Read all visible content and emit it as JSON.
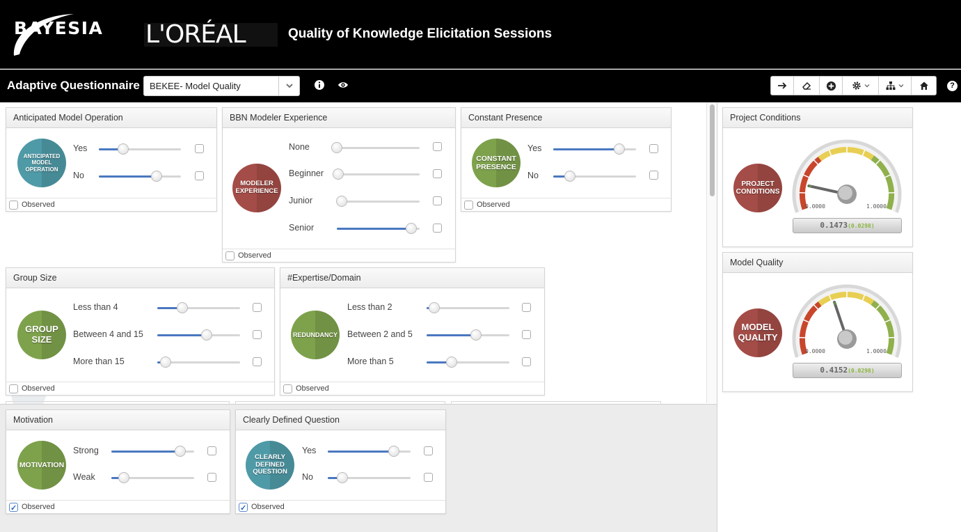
{
  "header": {
    "bayesia_logo": "BAYESIA",
    "loreal_logo": "L'ORÉAL",
    "title": "Quality of Knowledge Elicitation Sessions"
  },
  "toolbar": {
    "title": "Adaptive Questionnaire",
    "questionnaire_select": "BEKEE- Model Quality",
    "icons": [
      "info-icon",
      "eye-icon",
      "arrow-right-icon",
      "eraser-icon",
      "plus-circle-icon",
      "gear-icon",
      "hierarchy-icon",
      "home-icon",
      "help-icon"
    ],
    "help": "?"
  },
  "observed_label": "Observed",
  "colors": {
    "teal": "#4f9aa7",
    "red": "#a44c47",
    "green": "#7ea24c",
    "slider_fill": "#4a78c0"
  },
  "cards": {
    "anticipated": {
      "title": "Anticipated Model Operation",
      "node": "ANTICIPATED MODEL OPERATION",
      "states": [
        {
          "label": "Yes",
          "value": 0.3
        },
        {
          "label": "No",
          "value": 0.7
        }
      ],
      "observed": false
    },
    "experience": {
      "title": "BBN Modeler Experience",
      "node": "MODELER EXPERIENCE",
      "states": [
        {
          "label": "None",
          "value": 0.0
        },
        {
          "label": "Beginner",
          "value": 0.02
        },
        {
          "label": "Junior",
          "value": 0.06
        },
        {
          "label": "Senior",
          "value": 0.9
        }
      ],
      "observed": false
    },
    "presence": {
      "title": "Constant Presence",
      "node": "CONSTANT PRESENCE",
      "states": [
        {
          "label": "Yes",
          "value": 0.8
        },
        {
          "label": "No",
          "value": 0.2
        }
      ],
      "observed": false
    },
    "group_size": {
      "title": "Group Size",
      "node": "GROUP SIZE",
      "states": [
        {
          "label": "Less than 4",
          "value": 0.3
        },
        {
          "label": "Between 4 and 15",
          "value": 0.6
        },
        {
          "label": "More than 15",
          "value": 0.1
        }
      ],
      "observed": false
    },
    "expertise": {
      "title": "#Expertise/Domain",
      "node": "REDUNDANCY",
      "states": [
        {
          "label": "Less than 2",
          "value": 0.09
        },
        {
          "label": "Between 2 and 5",
          "value": 0.6
        },
        {
          "label": "More than 5",
          "value": 0.3
        }
      ],
      "observed": false
    },
    "motivation": {
      "title": "Motivation",
      "node": "MOTIVATION",
      "states": [
        {
          "label": "Strong",
          "value": 0.83
        },
        {
          "label": "Weak",
          "value": 0.15
        }
      ],
      "observed": true
    },
    "question": {
      "title": "Clearly Defined Question",
      "node": "CLEARLY DEFINED QUESTION",
      "states": [
        {
          "label": "Yes",
          "value": 0.8
        },
        {
          "label": "No",
          "value": 0.18
        }
      ],
      "observed": true
    }
  },
  "gauges": {
    "project": {
      "title": "Project Conditions",
      "node": "PROJECT CONDITIONS",
      "min_label": "0.0000",
      "max_label": "1.0000",
      "value": 0.1473,
      "value_text": "0.1473",
      "sub_text": "(0.0298)"
    },
    "model": {
      "title": "Model Quality",
      "node": "MODEL QUALITY",
      "min_label": "0.0000",
      "max_label": "1.0000",
      "value": 0.4152,
      "value_text": "0.4152",
      "sub_text": "(0.0298)"
    }
  }
}
